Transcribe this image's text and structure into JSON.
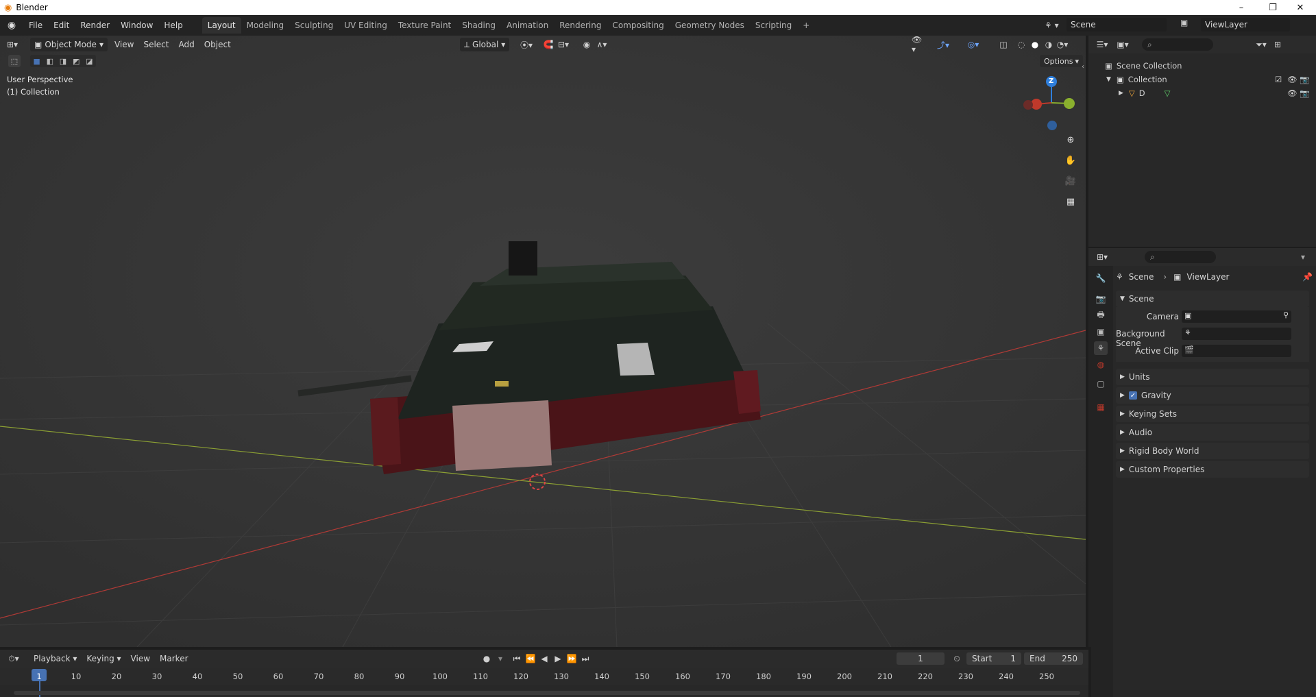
{
  "window": {
    "title": "Blender",
    "minimize": "–",
    "maximize": "❐",
    "close": "✕"
  },
  "menu": [
    "File",
    "Edit",
    "Render",
    "Window",
    "Help"
  ],
  "workspaces": [
    "Layout",
    "Modeling",
    "Sculpting",
    "UV Editing",
    "Texture Paint",
    "Shading",
    "Animation",
    "Rendering",
    "Compositing",
    "Geometry Nodes",
    "Scripting",
    "+"
  ],
  "scene_selector": {
    "scene": "Scene",
    "view_layer": "ViewLayer"
  },
  "viewport": {
    "mode": "Object Mode",
    "menus": [
      "View",
      "Select",
      "Add",
      "Object"
    ],
    "transform_orientation": "Global",
    "options_label": "Options",
    "overlay_text_1": "User Perspective",
    "overlay_text_2": "(1) Collection",
    "gizmo_z": "Z"
  },
  "outliner": {
    "root": "Scene Collection",
    "collection": "Collection",
    "object": "D"
  },
  "properties": {
    "breadcrumb_scene": "Scene",
    "breadcrumb_viewlayer": "ViewLayer",
    "panel_title": "Scene",
    "camera_label": "Camera",
    "background_scene_label": "Background Scene",
    "active_clip_label": "Active Clip",
    "collapsed_panels": [
      "Units",
      "Gravity",
      "Keying Sets",
      "Audio",
      "Rigid Body World",
      "Custom Properties"
    ]
  },
  "timeline": {
    "menus": [
      "Playback",
      "Keying",
      "View",
      "Marker"
    ],
    "current_frame": "1",
    "start_label": "Start",
    "start_value": "1",
    "end_label": "End",
    "end_value": "250",
    "ticks": [
      "1",
      "10",
      "20",
      "30",
      "40",
      "50",
      "60",
      "70",
      "80",
      "90",
      "100",
      "110",
      "120",
      "130",
      "140",
      "150",
      "160",
      "170",
      "180",
      "190",
      "200",
      "210",
      "220",
      "230",
      "240",
      "250"
    ]
  },
  "colors": {
    "accent": "#4772b3",
    "x_axis": "#c0392b",
    "y_axis": "#8ab02e",
    "z_axis": "#2f7fdc"
  }
}
